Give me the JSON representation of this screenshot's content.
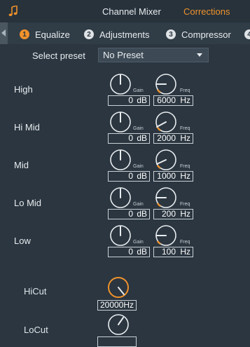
{
  "header": {
    "music_icon": "music-note-icon",
    "tabs": [
      {
        "label": "Channel Mixer",
        "active": false
      },
      {
        "label": "Corrections",
        "active": true
      }
    ]
  },
  "subtabs": [
    {
      "number": "1",
      "label": "Equalize",
      "active": true
    },
    {
      "number": "2",
      "label": "Adjustments",
      "active": false
    },
    {
      "number": "3",
      "label": "Compressor",
      "active": false
    },
    {
      "number": "4",
      "label": "",
      "active": false
    }
  ],
  "preset": {
    "label": "Select preset",
    "value": "No Preset"
  },
  "knob_captions": {
    "gain": "Gain",
    "freq": "Freq"
  },
  "bands": [
    {
      "label": "High",
      "gain": "0",
      "gain_unit": "dB",
      "freq": "6000",
      "freq_unit": "Hz"
    },
    {
      "label": "Hi Mid",
      "gain": "0",
      "gain_unit": "dB",
      "freq": "2000",
      "freq_unit": "Hz"
    },
    {
      "label": "Mid",
      "gain": "0",
      "gain_unit": "dB",
      "freq": "1000",
      "freq_unit": "Hz"
    },
    {
      "label": "Lo Mid",
      "gain": "0",
      "gain_unit": "dB",
      "freq": "200",
      "freq_unit": "Hz"
    },
    {
      "label": "Low",
      "gain": "0",
      "gain_unit": "dB",
      "freq": "100",
      "freq_unit": "Hz"
    }
  ],
  "cuts": [
    {
      "label": "HiCut",
      "value": "20000Hz"
    },
    {
      "label": "LoCut",
      "value": ""
    }
  ],
  "colors": {
    "accent": "#f0922b",
    "background": "#2b3640",
    "text": "#e8ecef"
  }
}
